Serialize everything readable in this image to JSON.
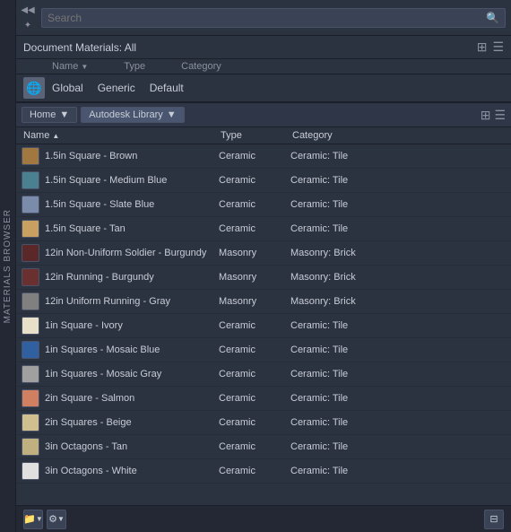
{
  "verticalTab": {
    "label": "MATERIALS BROWSER"
  },
  "search": {
    "placeholder": "Search",
    "value": ""
  },
  "docMaterials": {
    "title": "Document Materials: All",
    "columns": {
      "name": "Name",
      "type": "Type",
      "category": "Category"
    },
    "globalRow": {
      "name": "Global",
      "type": "Generic",
      "category": "Default"
    }
  },
  "library": {
    "homeTab": "Home",
    "autoDeskTab": "Autodesk Library",
    "columns": {
      "name": "Name",
      "type": "Type",
      "category": "Category"
    }
  },
  "materials": [
    {
      "name": "1.5in Square - Brown",
      "type": "Ceramic",
      "category": "Ceramic: Tile",
      "swatch": "swatch-brown"
    },
    {
      "name": "1.5in Square - Medium Blue",
      "type": "Ceramic",
      "category": "Ceramic: Tile",
      "swatch": "swatch-medblue"
    },
    {
      "name": "1.5in Square - Slate Blue",
      "type": "Ceramic",
      "category": "Ceramic: Tile",
      "swatch": "swatch-slateblue"
    },
    {
      "name": "1.5in Square - Tan",
      "type": "Ceramic",
      "category": "Ceramic: Tile",
      "swatch": "swatch-tan"
    },
    {
      "name": "12in Non-Uniform Soldier - Burgundy",
      "type": "Masonry",
      "category": "Masonry: Brick",
      "swatch": "swatch-burgundy-mask"
    },
    {
      "name": "12in Running - Burgundy",
      "type": "Masonry",
      "category": "Masonry: Brick",
      "swatch": "swatch-burgundy2"
    },
    {
      "name": "12in Uniform Running - Gray",
      "type": "Masonry",
      "category": "Masonry: Brick",
      "swatch": "swatch-gray-mask"
    },
    {
      "name": "1in Square - Ivory",
      "type": "Ceramic",
      "category": "Ceramic: Tile",
      "swatch": "swatch-ivory"
    },
    {
      "name": "1in Squares - Mosaic Blue",
      "type": "Ceramic",
      "category": "Ceramic: Tile",
      "swatch": "swatch-mosaicblue"
    },
    {
      "name": "1in Squares - Mosaic Gray",
      "type": "Ceramic",
      "category": "Ceramic: Tile",
      "swatch": "swatch-mosaicgray"
    },
    {
      "name": "2in Square - Salmon",
      "type": "Ceramic",
      "category": "Ceramic: Tile",
      "swatch": "swatch-salmon"
    },
    {
      "name": "2in Squares - Beige",
      "type": "Ceramic",
      "category": "Ceramic: Tile",
      "swatch": "swatch-beige"
    },
    {
      "name": "3in Octagons - Tan",
      "type": "Ceramic",
      "category": "Ceramic: Tile",
      "swatch": "swatch-tan2"
    },
    {
      "name": "3in Octagons - White",
      "type": "Ceramic",
      "category": "Ceramic: Tile",
      "swatch": "swatch-white"
    }
  ],
  "bottomBar": {
    "addLabel": "＋",
    "settingsLabel": "⚙"
  }
}
